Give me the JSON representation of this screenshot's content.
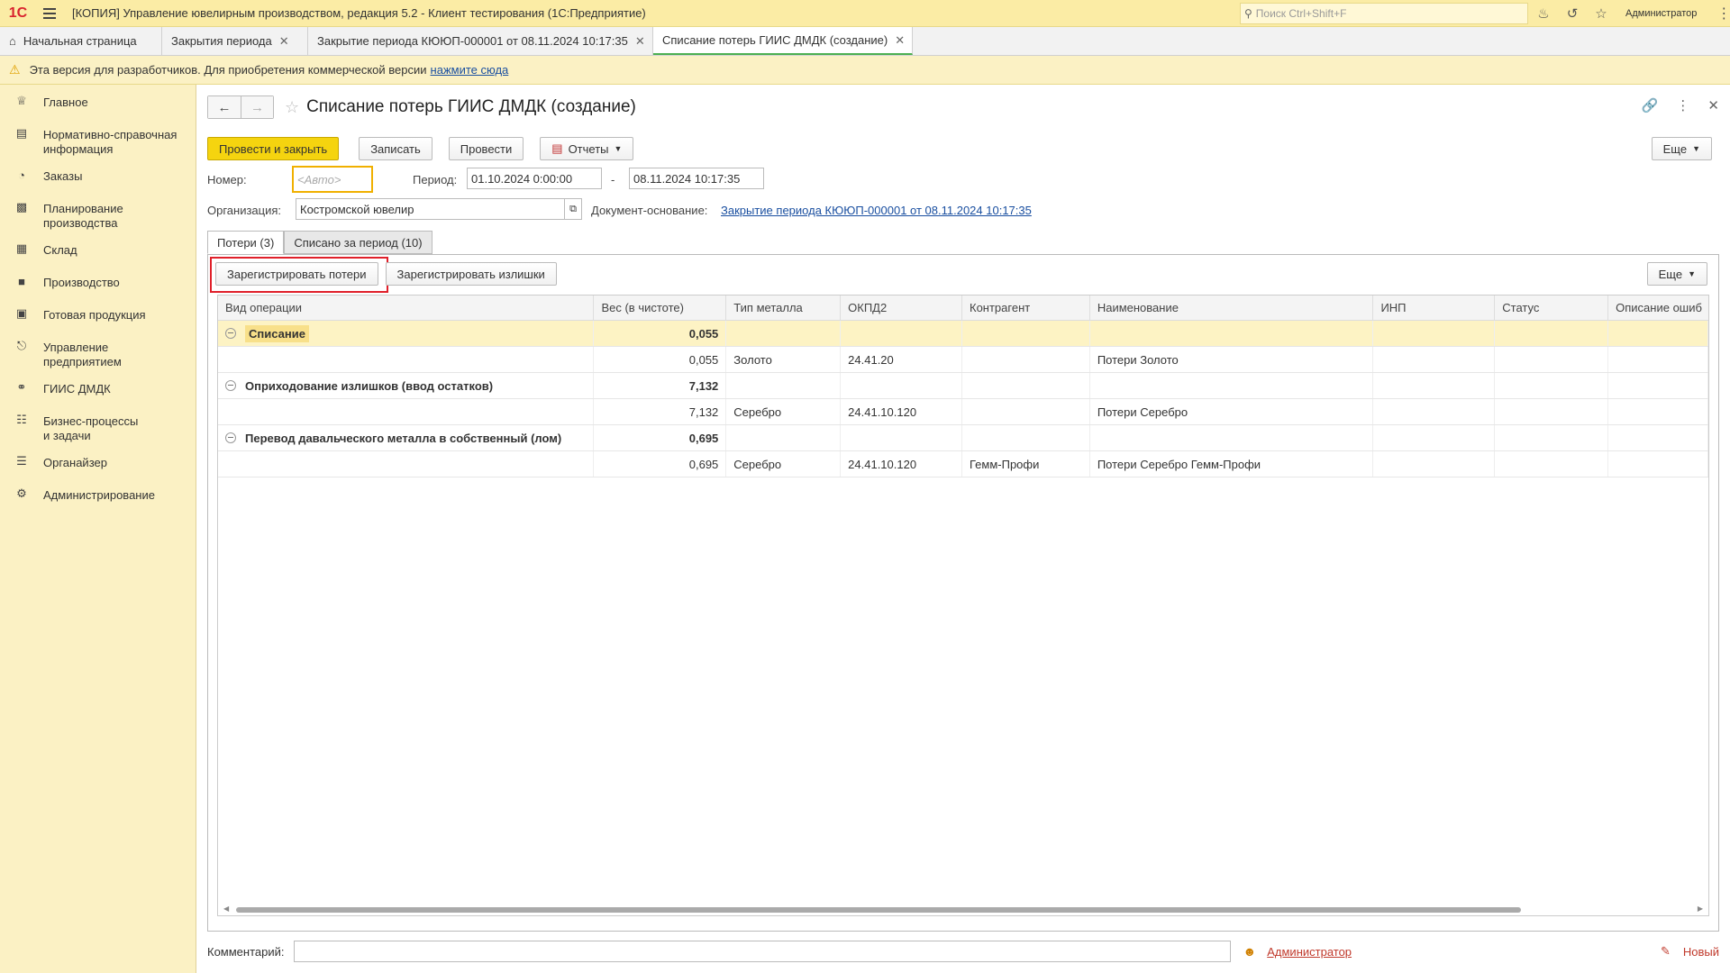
{
  "titlebar": {
    "logo": "1С",
    "title": "[КОПИЯ] Управление ювелирным производством, редакция 5.2  - Клиент тестирования (1С:Предприятие)",
    "search_placeholder": "Поиск Ctrl+Shift+F",
    "user": "Администратор"
  },
  "tabs": {
    "home": "Начальная страница",
    "items": [
      {
        "label": "Закрытия периода"
      },
      {
        "label": "Закрытие периода КЮЮП-000001 от 08.11.2024 10:17:35"
      },
      {
        "label": "Списание потерь ГИИС ДМДК (создание)"
      }
    ]
  },
  "warning": {
    "text": "Эта версия для разработчиков. Для приобретения коммерческой версии",
    "link": "нажмите сюда"
  },
  "sidebar": {
    "items": [
      {
        "label": "Главное",
        "icon": "crown-icon"
      },
      {
        "label": "Нормативно-справочная информация",
        "icon": "book-icon"
      },
      {
        "label": "Заказы",
        "icon": "pie-icon"
      },
      {
        "label": "Планирование производства",
        "icon": "clipboard-icon"
      },
      {
        "label": "Склад",
        "icon": "grid-icon"
      },
      {
        "label": "Производство",
        "icon": "factory-icon"
      },
      {
        "label": "Готовая продукция",
        "icon": "bag-icon"
      },
      {
        "label": "Управление предприятием",
        "icon": "org-icon"
      },
      {
        "label": "ГИИС ДМДК",
        "icon": "ring-icon"
      },
      {
        "label": "Бизнес-процессы и задачи",
        "icon": "tasks-icon"
      },
      {
        "label": "Органайзер",
        "icon": "organizer-icon"
      },
      {
        "label": "Администрирование",
        "icon": "gear-icon"
      }
    ]
  },
  "form": {
    "title": "Списание потерь ГИИС ДМДК (создание)",
    "buttons": {
      "post_close": "Провести и закрыть",
      "save": "Записать",
      "post": "Провести",
      "reports": "Отчеты",
      "more": "Еще"
    },
    "fields": {
      "number_label": "Номер:",
      "number_placeholder": "<Авто>",
      "period_label": "Период:",
      "period_from": "01.10.2024  0:00:00",
      "period_dash": "-",
      "period_to": "08.11.2024 10:17:35",
      "org_label": "Организация:",
      "org_value": "Костромской ювелир",
      "basis_label": "Документ-основание:",
      "basis_link": "Закрытие периода КЮЮП-000001 от 08.11.2024 10:17:35"
    },
    "tabs": [
      "Потери (3)",
      "Списано за период (10)"
    ],
    "panel_buttons": {
      "register_losses": "Зарегистрировать потери",
      "register_surplus": "Зарегистрировать излишки",
      "more": "Еще"
    },
    "table": {
      "columns": [
        "Вид операции",
        "Вес (в чистоте)",
        "Тип металла",
        "ОКПД2",
        "Контрагент",
        "Наименование",
        "ИНП",
        "Статус",
        "Описание ошиб"
      ],
      "rows": [
        {
          "group": true,
          "op": "Списание",
          "weight": "0,055",
          "metal": "",
          "okpd": "",
          "contractor": "",
          "name": "",
          "selected": true
        },
        {
          "group": false,
          "op": "",
          "weight": "0,055",
          "metal": "Золото",
          "okpd": "24.41.20",
          "contractor": "",
          "name": "Потери Золото"
        },
        {
          "group": true,
          "op": "Оприходование излишков (ввод остатков)",
          "weight": "7,132",
          "metal": "",
          "okpd": "",
          "contractor": "",
          "name": ""
        },
        {
          "group": false,
          "op": "",
          "weight": "7,132",
          "metal": "Серебро",
          "okpd": "24.41.10.120",
          "contractor": "",
          "name": "Потери Серебро"
        },
        {
          "group": true,
          "op": "Перевод давальческого металла в собственный (лом)",
          "weight": "0,695",
          "metal": "",
          "okpd": "",
          "contractor": "",
          "name": ""
        },
        {
          "group": false,
          "op": "",
          "weight": "0,695",
          "metal": "Серебро",
          "okpd": "24.41.10.120",
          "contractor": "Гемм-Профи",
          "name": "Потери Серебро Гемм-Профи"
        }
      ]
    },
    "footer": {
      "comment_label": "Комментарий:",
      "author": "Администратор",
      "status": "Новый"
    }
  },
  "colors": {
    "accent_yellow": "#f5d40f",
    "sidebar_bg": "#fbf1c4",
    "highlight_red": "#e0202a",
    "link_blue": "#1a4fa0"
  }
}
